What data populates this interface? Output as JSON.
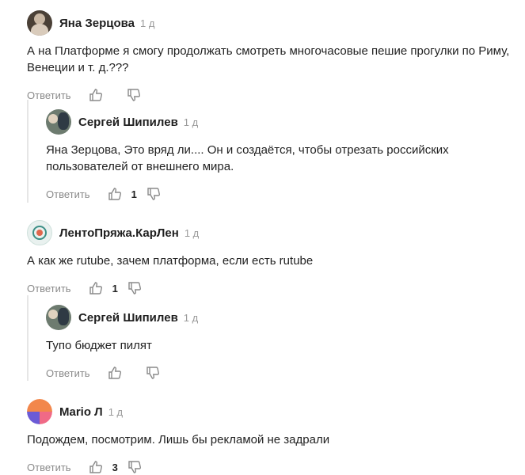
{
  "comments": [
    {
      "author": "Яна Зерцова",
      "time": "1 д",
      "text": "А на Платформе я смогу продолжать смотреть многочасовые пешие прогулки по Риму, Венеции и т. д.???",
      "reply_label": "Ответить",
      "likes": "",
      "avatar_icon": "user-photo"
    },
    {
      "author": "Сергей Шипилев",
      "time": "1 д",
      "text": "Яна Зерцова, Это вряд ли.... Он и создаётся, чтобы отрезать российских пользователей от внешнего мира.",
      "reply_label": "Ответить",
      "likes": "1",
      "avatar_icon": "user-photo"
    },
    {
      "author": "ЛентоПряжа.КарЛен",
      "time": "1 д",
      "text": "А как же rutube, зачем платформа, если есть rutube",
      "reply_label": "Ответить",
      "likes": "1",
      "avatar_icon": "channel-logo"
    },
    {
      "author": "Сергей Шипилев",
      "time": "1 д",
      "text": "Тупо бюджет пилят",
      "reply_label": "Ответить",
      "likes": "",
      "avatar_icon": "user-photo"
    },
    {
      "author": "Mario Л",
      "time": "1 д",
      "text": "Подождем, посмотрим. Лишь бы рекламой не задрали",
      "reply_label": "Ответить",
      "likes": "3",
      "avatar_icon": "user-logo"
    }
  ],
  "icons": {
    "like": "thumb-up-icon",
    "dislike": "thumb-down-icon"
  },
  "colors": {
    "text": "#222222",
    "muted": "#8a8a8a",
    "thread_line": "#e6e6e6"
  }
}
